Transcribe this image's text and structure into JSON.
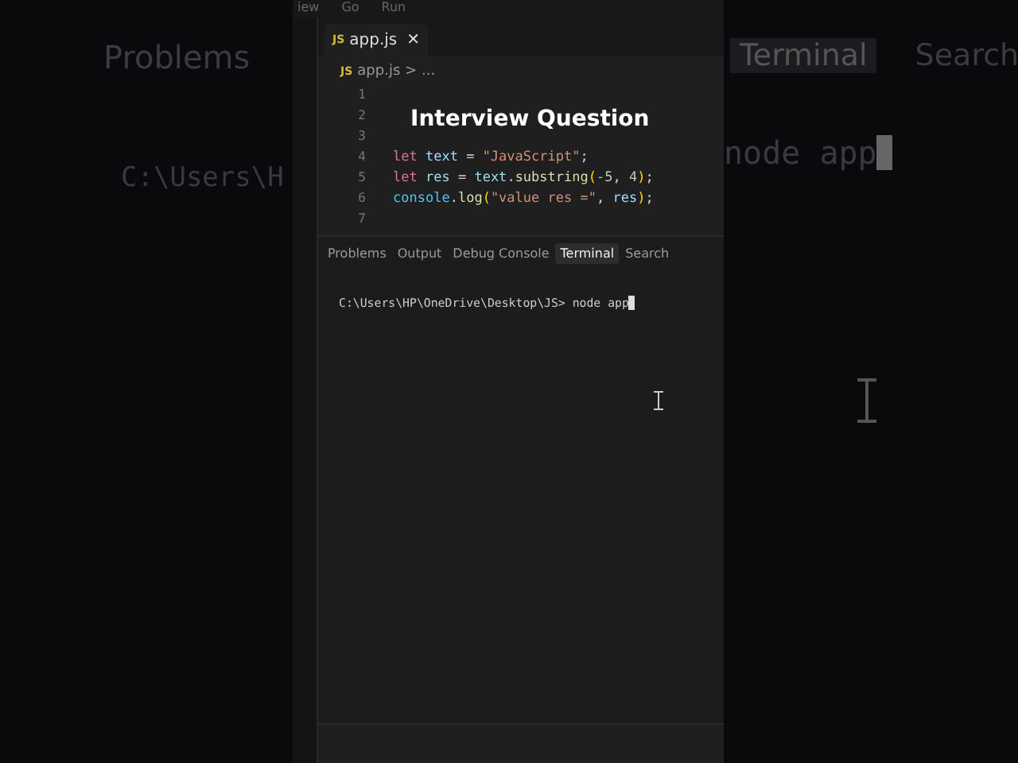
{
  "backdrop": {
    "left": {
      "tab": "Problems",
      "path": "C:\\Users\\H"
    },
    "right": {
      "tabs": [
        {
          "label": "Terminal",
          "selected": true
        },
        {
          "label": "Search",
          "selected": false
        }
      ],
      "command": "node app"
    }
  },
  "menu": [
    "iew",
    "Go",
    "Run"
  ],
  "editor_tabs": [
    {
      "label": "app.js",
      "badge": "JS",
      "close": "✕",
      "selected": true
    }
  ],
  "breadcrumb": {
    "badge": "JS",
    "file": "app.js",
    "rest": "> ..."
  },
  "code_lines": [
    {
      "number": "1"
    },
    {
      "number": "2"
    },
    {
      "number": "3"
    },
    {
      "number": "4",
      "tokens": [
        {
          "kind": "keyword",
          "text": "let"
        },
        {
          "kind": "variable",
          "text": " text"
        },
        {
          "kind": "punct",
          "text": " = "
        },
        {
          "kind": "string",
          "text": "\"JavaScript\""
        },
        {
          "kind": "punct",
          "text": ";"
        }
      ]
    },
    {
      "number": "5",
      "tokens": [
        {
          "kind": "keyword",
          "text": "let"
        },
        {
          "kind": "variable",
          "text": " res"
        },
        {
          "kind": "punct",
          "text": " = "
        },
        {
          "kind": "variable",
          "text": "text"
        },
        {
          "kind": "punct",
          "text": "."
        },
        {
          "kind": "method",
          "text": "substring"
        },
        {
          "kind": "bracket",
          "text": "("
        },
        {
          "kind": "number",
          "text": "-5"
        },
        {
          "kind": "punct",
          "text": ", "
        },
        {
          "kind": "number",
          "text": "4"
        },
        {
          "kind": "bracket",
          "text": ")"
        },
        {
          "kind": "punct",
          "text": ";"
        }
      ]
    },
    {
      "number": "6",
      "tokens": [
        {
          "kind": "object",
          "text": "console"
        },
        {
          "kind": "punct",
          "text": "."
        },
        {
          "kind": "method",
          "text": "log"
        },
        {
          "kind": "bracket",
          "text": "("
        },
        {
          "kind": "string",
          "text": "\"value res =\""
        },
        {
          "kind": "punct",
          "text": ", "
        },
        {
          "kind": "variable",
          "text": "res"
        },
        {
          "kind": "bracket",
          "text": ")"
        },
        {
          "kind": "punct",
          "text": ";"
        }
      ]
    },
    {
      "number": "7"
    }
  ],
  "caption": "Interview Question",
  "panel_tabs": [
    {
      "label": "Problems",
      "selected": false
    },
    {
      "label": "Output",
      "selected": false
    },
    {
      "label": "Debug Console",
      "selected": false
    },
    {
      "label": "Terminal",
      "selected": true
    },
    {
      "label": "Search",
      "selected": false
    }
  ],
  "terminal": {
    "prompt": "C:\\Users\\HP\\OneDrive\\Desktop\\JS>",
    "command": "node app"
  }
}
